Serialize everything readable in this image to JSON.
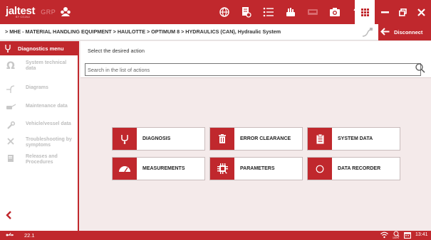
{
  "app": {
    "logo_text": "jaltest",
    "logo_sub": "BY COJALI",
    "group_text": "GRP"
  },
  "breadcrumb": "> MHE - MATERIAL HANDLING EQUIPMENT  >  HAULOTTE  >  OPTIMUM 8  >  HYDRAULICS (CAN), Hydraulic System",
  "toolbar": {
    "disconnect_label": "Disconnect"
  },
  "sidebar": {
    "active_label": "Diagnostics menu",
    "items": [
      {
        "label": "System technical data",
        "icon": "omega-icon"
      },
      {
        "label": "Diagrams",
        "icon": "diagram-icon"
      },
      {
        "label": "Maintenance data",
        "icon": "oil-can-icon"
      },
      {
        "label": "Vehicle/vessel data",
        "icon": "wrench-icon"
      },
      {
        "label": "Troubleshooting by symptoms",
        "icon": "tools-icon"
      },
      {
        "label": "Releases and Procedures",
        "icon": "book-icon"
      }
    ]
  },
  "main": {
    "instruction": "Select the desired action",
    "search_placeholder": "Search in the list of actions",
    "actions": [
      {
        "label": "DIAGNOSIS",
        "icon": "stethoscope-icon"
      },
      {
        "label": "ERROR CLEARANCE",
        "icon": "trash-icon"
      },
      {
        "label": "SYSTEM DATA",
        "icon": "clipboard-icon"
      },
      {
        "label": "MEASUREMENTS",
        "icon": "gauge-icon"
      },
      {
        "label": "PARAMETERS",
        "icon": "chip-icon"
      },
      {
        "label": "DATA RECORDER",
        "icon": "record-icon"
      }
    ]
  },
  "status": {
    "version": "22.1",
    "zoom": "100%",
    "time": "13:41"
  },
  "colors": {
    "brand_red": "#c0282d",
    "background": "#f4eaea"
  }
}
